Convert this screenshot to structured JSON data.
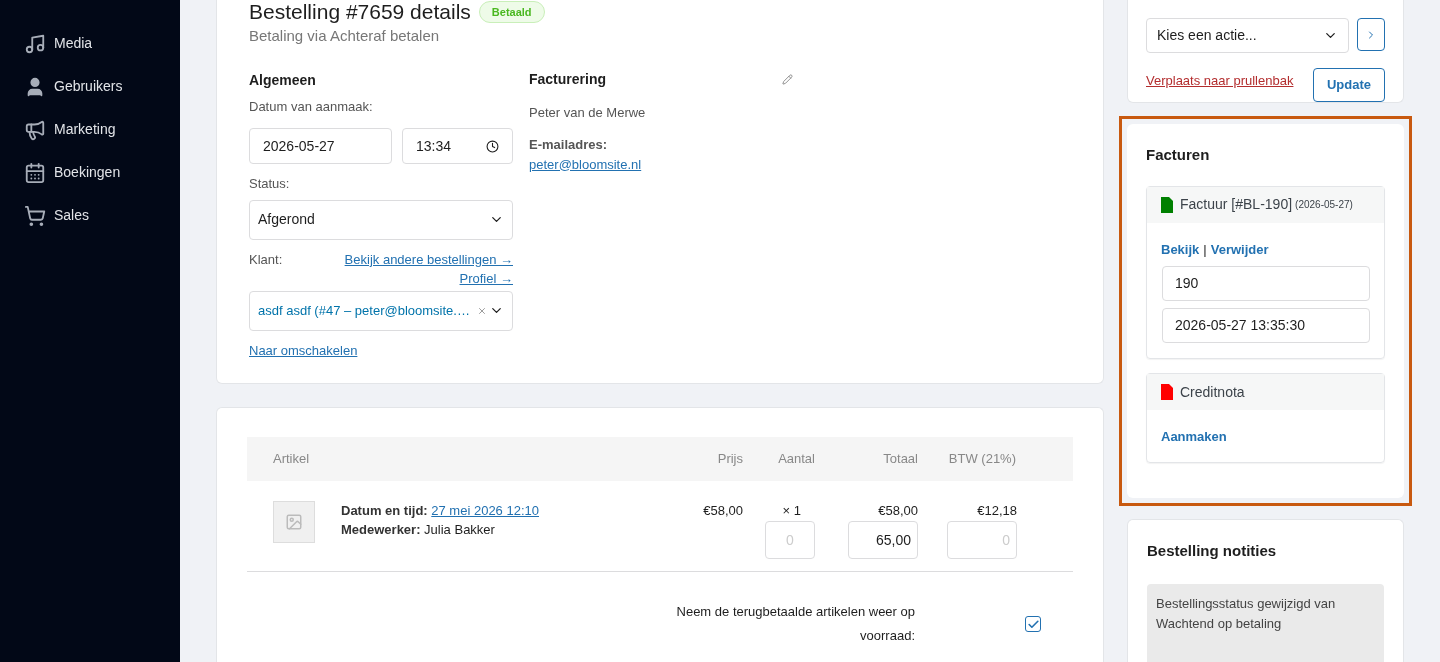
{
  "sidebar": {
    "items": [
      {
        "label": "Media"
      },
      {
        "label": "Gebruikers"
      },
      {
        "label": "Marketing"
      },
      {
        "label": "Boekingen"
      },
      {
        "label": "Sales"
      }
    ]
  },
  "order": {
    "title": "Bestelling #7659 details",
    "status_badge": "Betaald",
    "subtitle": "Betaling via Achteraf betalen"
  },
  "general": {
    "heading": "Algemeen",
    "date_label": "Datum van aanmaak:",
    "date": "2026-05-27",
    "time": "13:34",
    "status_label": "Status:",
    "status": "Afgerond",
    "customer_label": "Klant:",
    "links": [
      "Bekijk andere bestellingen →",
      "Profiel →"
    ],
    "customer": "asdf asdf (#47 – peter@bloomsite.…",
    "switch_link": "Naar omschakelen"
  },
  "billing": {
    "heading": "Facturering",
    "name": "Peter van de Merwe",
    "email_label": "E-mailadres:",
    "email": "peter@bloomsite.nl"
  },
  "items_table": {
    "columns": [
      "Artikel",
      "Prijs",
      "Aantal",
      "Totaal",
      "BTW (21%)"
    ],
    "rows": [
      {
        "date_label": "Datum en tijd:",
        "date": "27 mei 2026 12:10",
        "staff_label": "Medewerker:",
        "staff": "Julia Bakker",
        "price": "€58,00",
        "quantity": "× 1",
        "refund_quantity_placeholder": "0",
        "total": "€58,00",
        "refund_total": "65,00",
        "tax": "€12,18",
        "refund_tax_placeholder": "0"
      }
    ]
  },
  "restock": {
    "label": "Neem de terugbetaalde artikelen weer op voorraad:",
    "checked": true
  },
  "actions": {
    "select": "Kies een actie...",
    "trash_link": "Verplaats naar prullenbak",
    "update_button": "Update"
  },
  "invoices": {
    "heading": "Facturen",
    "highlighted": true,
    "documents": [
      {
        "kind": "invoice",
        "title": "Factuur [#BL-190]",
        "date": "(2026-05-27)",
        "color": "#008000",
        "links": [
          "Bekijk",
          "Verwijder"
        ],
        "separator": "|",
        "fields": [
          "190",
          "2026-05-27 13:35:30"
        ]
      },
      {
        "kind": "credit_note",
        "title": "Creditnota",
        "color": "#ff0000",
        "links": [
          "Aanmaken"
        ]
      }
    ]
  },
  "notes": {
    "heading": "Bestelling notities",
    "items": [
      {
        "text": "Bestellingsstatus gewijzigd van Wachtend op betaling"
      }
    ]
  }
}
